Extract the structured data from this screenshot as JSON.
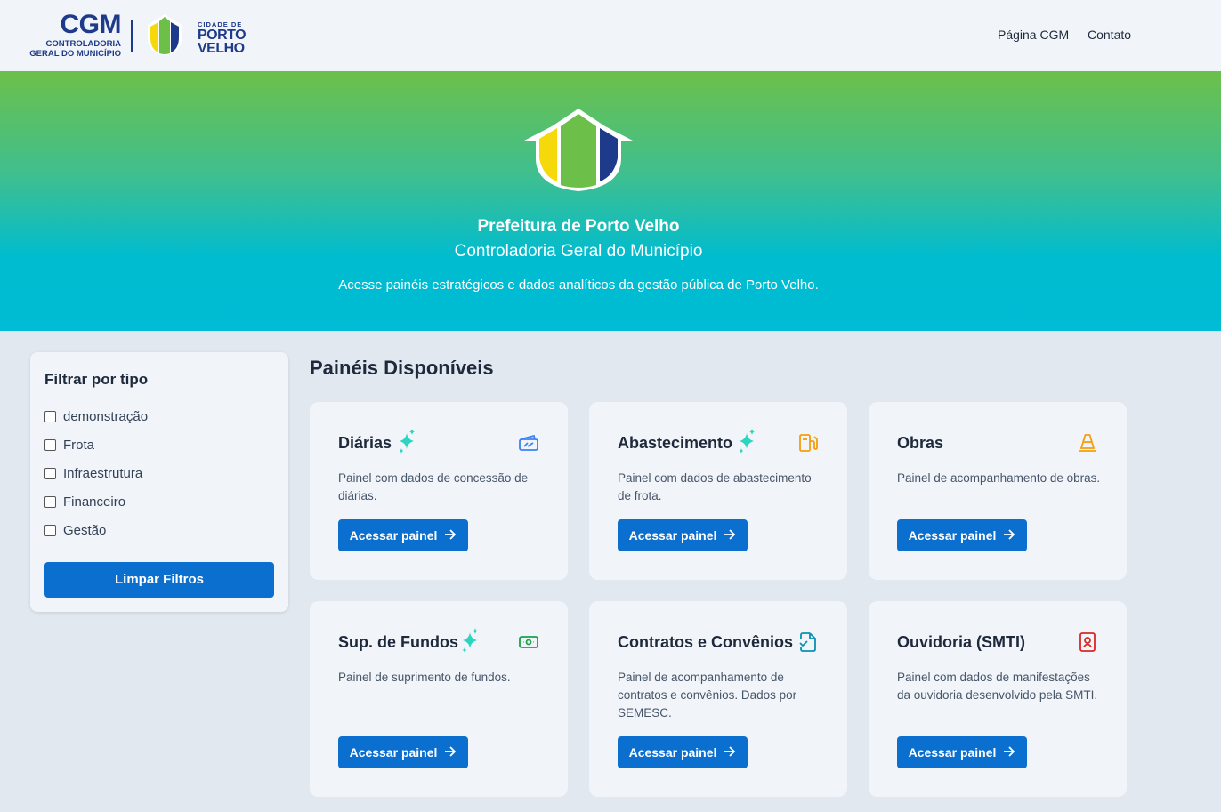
{
  "header": {
    "cgm_logo": {
      "big": "CGM",
      "line1": "CONTROLADORIA",
      "line2": "GERAL DO MUNICÍPIO"
    },
    "city_logo": {
      "line1": "CIDADE DE",
      "line2": "PORTO",
      "line3": "VELHO"
    },
    "nav": {
      "pagina_cgm": "Página CGM",
      "contato": "Contato"
    }
  },
  "hero": {
    "title": "Prefeitura de Porto Velho",
    "subtitle": "Controladoria Geral do Município",
    "description": "Acesse painéis estratégicos e dados analíticos da gestão pública de Porto Velho."
  },
  "sidebar": {
    "title": "Filtrar por tipo",
    "filters": [
      {
        "label": "demonstração",
        "checked": false
      },
      {
        "label": "Frota",
        "checked": false
      },
      {
        "label": "Infraestrutura",
        "checked": false
      },
      {
        "label": "Financeiro",
        "checked": false
      },
      {
        "label": "Gestão",
        "checked": false
      }
    ],
    "clear_label": "Limpar Filtros"
  },
  "main": {
    "title": "Painéis Disponíveis",
    "cards": [
      {
        "title": "Diárias",
        "new": true,
        "icon": "ticket-icon",
        "icon_color": "#3b82f6",
        "description": "Painel com dados de concessão de diárias.",
        "button": "Acessar painel"
      },
      {
        "title": "Abastecimento",
        "new": true,
        "icon": "fuel-pump-icon",
        "icon_color": "#f59e0b",
        "description": "Painel com dados de abastecimento de frota.",
        "button": "Acessar painel"
      },
      {
        "title": "Obras",
        "new": false,
        "icon": "traffic-cone-icon",
        "icon_color": "#f59e0b",
        "description": "Painel de acompanhamento de obras.",
        "button": "Acessar painel"
      },
      {
        "title": "Sup. de Fundos",
        "new": true,
        "icon": "banknote-icon",
        "icon_color": "#16a34a",
        "description": "Painel de suprimento de fundos.",
        "button": "Acessar painel"
      },
      {
        "title": "Contratos e Convênios",
        "new": false,
        "icon": "file-check-icon",
        "icon_color": "#0891b2",
        "description": "Painel de acompanhamento de contratos e convênios. Dados por SEMESC.",
        "button": "Acessar painel"
      },
      {
        "title": "Ouvidoria (SMTI)",
        "new": false,
        "icon": "contact-book-icon",
        "icon_color": "#dc2626",
        "description": "Painel com dados de manifestações da ouvidoria desenvolvido pela SMTI.",
        "button": "Acessar painel"
      }
    ]
  },
  "colors": {
    "primary_button": "#0b6fd0",
    "hero_green": "#6cc04a",
    "hero_cyan": "#00bcd4",
    "brand_blue": "#1e3a8a",
    "sparkle": "#2dd4bf"
  }
}
